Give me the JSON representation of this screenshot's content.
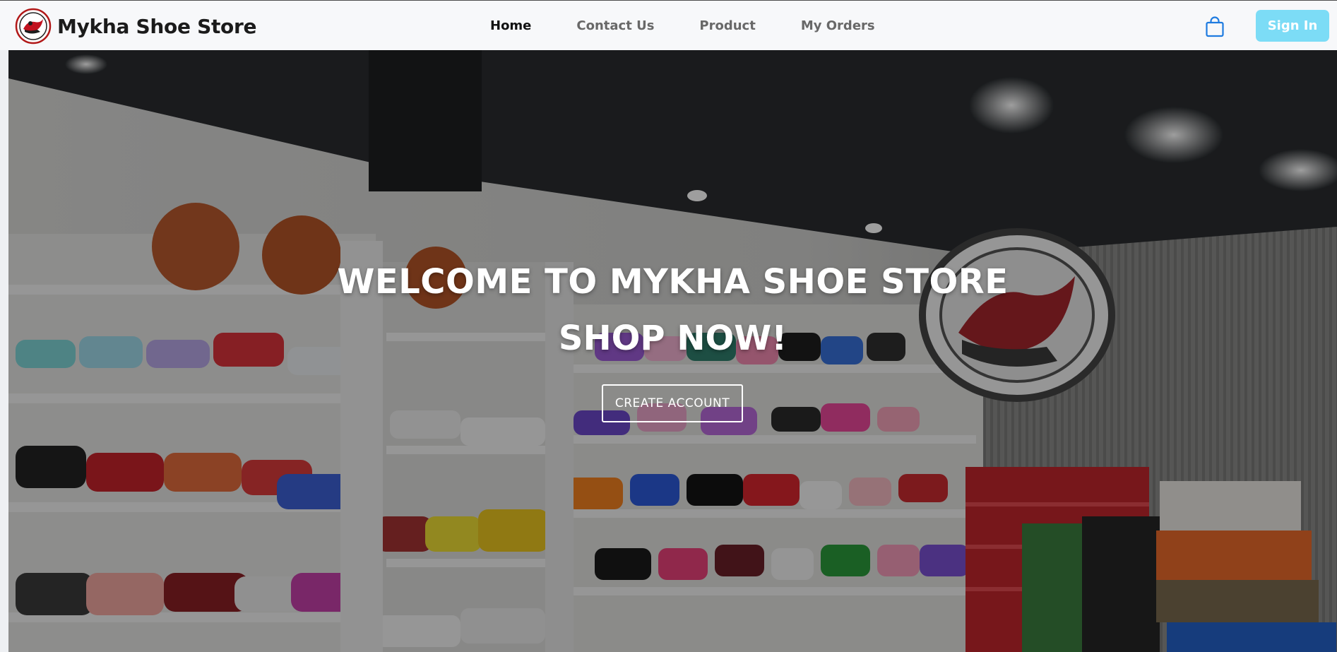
{
  "navbar": {
    "brand_name": "Mykha Shoe Store",
    "links": [
      {
        "label": "Home",
        "active": true
      },
      {
        "label": "Contact Us",
        "active": false
      },
      {
        "label": "Product",
        "active": false
      },
      {
        "label": "My Orders",
        "active": false
      }
    ],
    "cart_icon": "shopping-bag-icon",
    "signin_label": "Sign In"
  },
  "hero": {
    "title": "WELCOME TO MYKHA SHOE STORE",
    "subtitle": "SHOP NOW!",
    "cta_label": "CREATE ACCOUNT"
  },
  "colors": {
    "signin_bg": "#7cdcf6",
    "cart_icon": "#1e7be0",
    "nav_active": "#121212",
    "nav_inactive": "#686868"
  }
}
